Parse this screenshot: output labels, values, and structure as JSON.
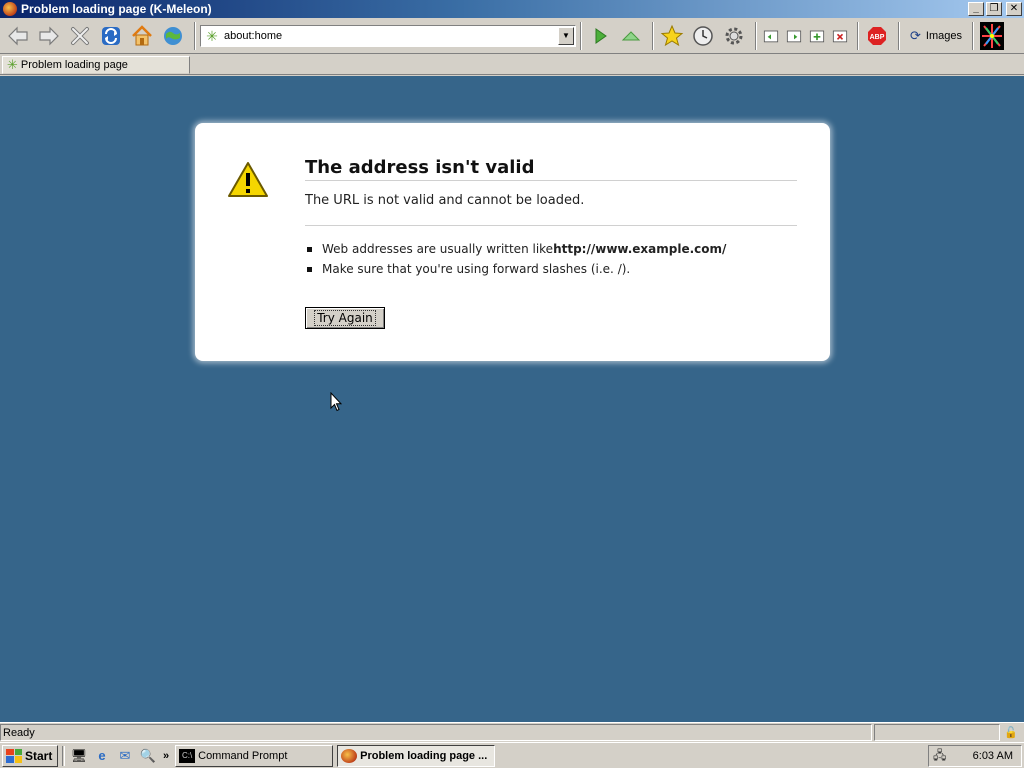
{
  "window": {
    "title": "Problem loading page (K-Meleon)",
    "controls": [
      "_",
      "❐",
      "✕"
    ]
  },
  "toolbar": {
    "url": "about:home",
    "images_label": "Images"
  },
  "tab": {
    "label": "Problem loading page"
  },
  "error": {
    "title": "The address isn't valid",
    "description": "The URL is not valid and cannot be loaded.",
    "bullet1_prefix": "Web addresses are usually written like ",
    "bullet1_example": "http://www.example.com/",
    "bullet2": "Make sure that you're using forward slashes (i.e. /).",
    "button": "Try Again"
  },
  "status": {
    "text": "Ready"
  },
  "taskbar": {
    "start": "Start",
    "more": "»",
    "tasks": [
      {
        "label": "Command Prompt",
        "icon": "cmd-icon"
      },
      {
        "label": "Problem loading page ...",
        "icon": "kmeleon-icon"
      }
    ],
    "clock": "6:03 AM"
  },
  "colors": {
    "page_background": "#36658a",
    "titlebar_start": "#0a246a",
    "titlebar_end": "#a6caf0"
  }
}
